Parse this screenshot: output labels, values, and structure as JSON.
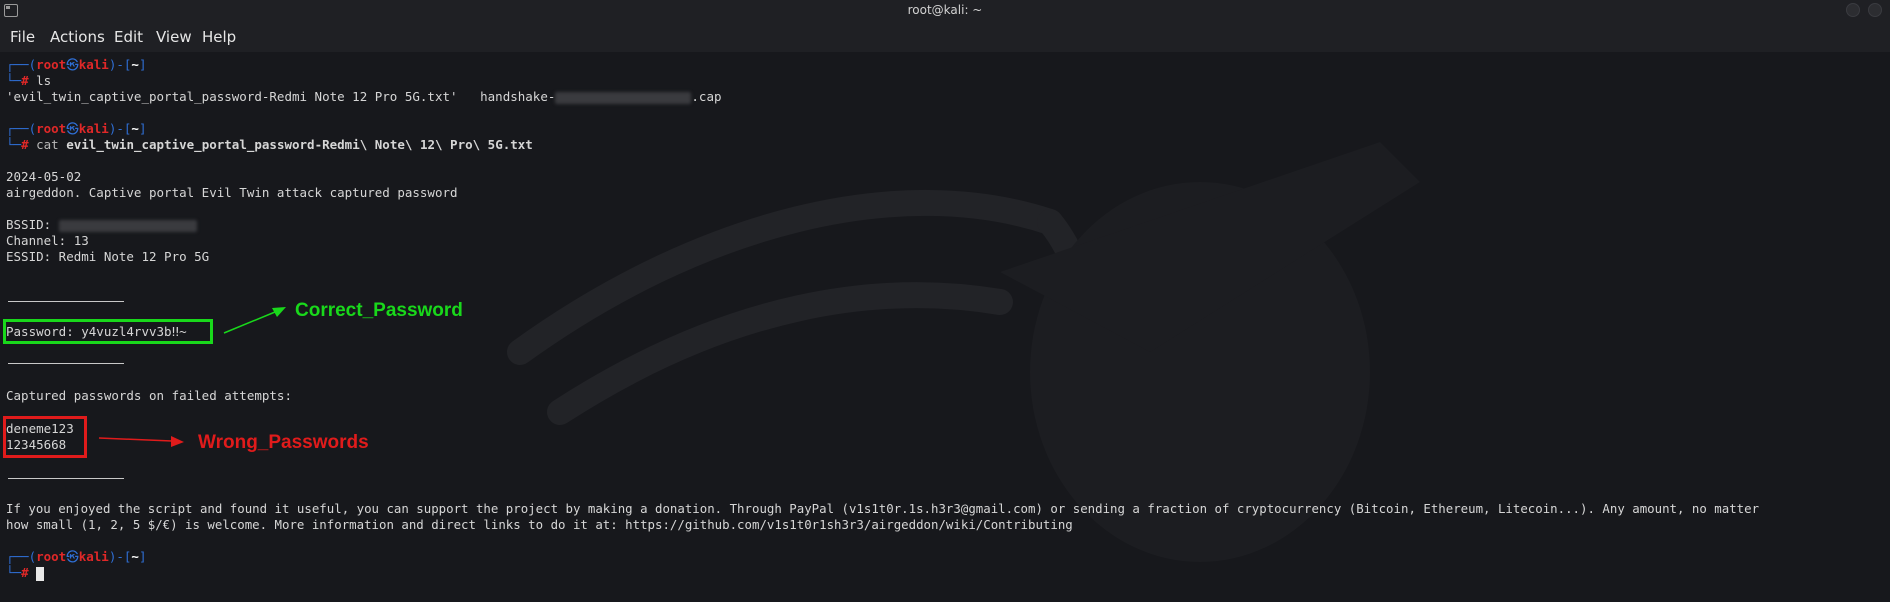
{
  "window": {
    "title": "root@kali: ~"
  },
  "menu": {
    "items": [
      "File",
      "Actions",
      "Edit",
      "View",
      "Help"
    ]
  },
  "prompt": {
    "corner_top": "┌──(",
    "user": "root",
    "at": "㉿",
    "host": "kali",
    "mid": ")-[",
    "dir": "~",
    "end": "]",
    "corner_bottom": "└─",
    "hash": "#"
  },
  "terminal": {
    "cmd1": " ls",
    "ls_file1": "'evil_twin_captive_portal_password-Redmi Note 12 Pro 5G.txt'",
    "ls_file2_prefix": "handshake-",
    "ls_file2_suffix": ".cap",
    "cmd2_verb": " cat",
    "cmd2_arg": "evil_twin_captive_portal_password-Redmi\\ Note\\ 12\\ Pro\\ 5G.txt",
    "date": "2024-05-02",
    "header": "airgeddon. Captive portal Evil Twin attack captured password",
    "bssid_label": "BSSID: ",
    "channel": "Channel: 13",
    "essid": "ESSID: Redmi Note 12 Pro 5G",
    "password_line": "Password: y4vuzl4rvv3b‼~",
    "failed_header": "Captured passwords on failed attempts:",
    "failed_1": "deneme123",
    "failed_2": "12345668",
    "donate_1": "If you enjoyed the script and found it useful, you can support the project by making a donation. Through PayPal (v1s1t0r.1s.h3r3@gmail.com) or sending a fraction of cryptocurrency (Bitcoin, Ethereum, Litecoin...). Any amount, no matter",
    "donate_2": "how small (1, 2, 5 $/€) is welcome. More information and direct links to do it at: https://github.com/v1s1t0r1sh3r3/airgeddon/wiki/Contributing"
  },
  "annotations": {
    "correct_label": "Correct_Password",
    "wrong_label": "Wrong_Passwords",
    "correct_color": "#19d81b",
    "wrong_color": "#e01b1b"
  }
}
